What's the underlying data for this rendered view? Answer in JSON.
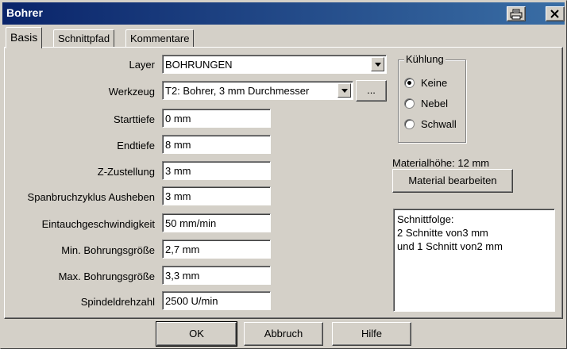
{
  "window": {
    "title": "Bohrer"
  },
  "tabs": [
    {
      "label": "Basis"
    },
    {
      "label": "Schnittpfad"
    },
    {
      "label": "Kommentare"
    }
  ],
  "form": {
    "layer": {
      "label": "Layer",
      "value": "BOHRUNGEN"
    },
    "werkzeug": {
      "label": "Werkzeug",
      "value": "T2: Bohrer, 3 mm Durchmesser",
      "browse_label": "..."
    },
    "starttiefe": {
      "label": "Starttiefe",
      "value": "0 mm"
    },
    "endtiefe": {
      "label": "Endtiefe",
      "value": "8 mm"
    },
    "zzustellung": {
      "label": "Z-Zustellung",
      "value": "3 mm"
    },
    "spanbruch": {
      "label": "Spanbruchzyklus Ausheben",
      "value": "3 mm"
    },
    "eintauch": {
      "label": "Eintauchgeschwindigkeit",
      "value": "50 mm/min"
    },
    "minbohrung": {
      "label": "Min. Bohrungsgröße",
      "value": "2,7 mm"
    },
    "maxbohrung": {
      "label": "Max. Bohrungsgröße",
      "value": "3,3 mm"
    },
    "spindel": {
      "label": "Spindeldrehzahl",
      "value": "2500 U/min"
    }
  },
  "kuehlung": {
    "title": "Kühlung",
    "options": [
      {
        "label": "Keine",
        "selected": true
      },
      {
        "label": "Nebel",
        "selected": false
      },
      {
        "label": "Schwall",
        "selected": false
      }
    ]
  },
  "material": {
    "height_text": "Materialhöhe: 12 mm",
    "edit_label": "Material bearbeiten"
  },
  "schnittfolge": {
    "lines": [
      "Schnittfolge:",
      "2 Schnitte von3 mm",
      "und 1 Schnitt von2 mm"
    ]
  },
  "footer": {
    "ok_label": "OK",
    "cancel_label": "Abbruch",
    "help_label": "Hilfe"
  },
  "colors": {
    "titlebar_start": "#0a246a",
    "titlebar_end": "#3a6ea5",
    "face": "#d4d0c8"
  }
}
